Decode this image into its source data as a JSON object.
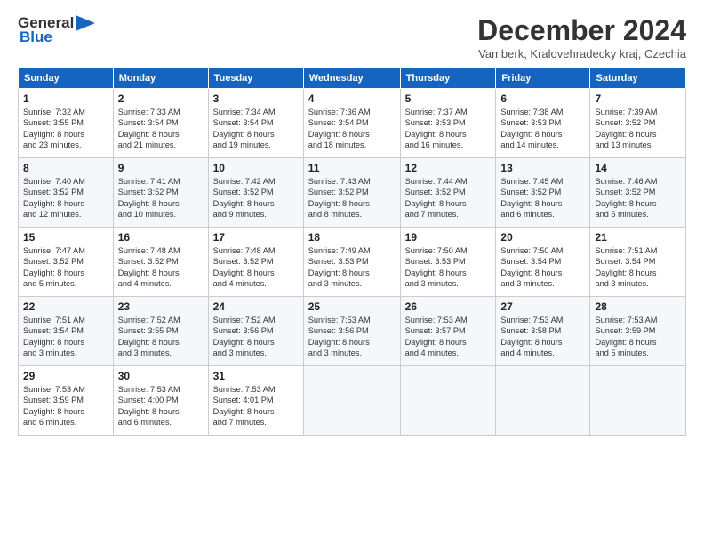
{
  "header": {
    "logo_general": "General",
    "logo_blue": "Blue",
    "month_title": "December 2024",
    "subtitle": "Vamberk, Kralovehradecky kraj, Czechia"
  },
  "weekdays": [
    "Sunday",
    "Monday",
    "Tuesday",
    "Wednesday",
    "Thursday",
    "Friday",
    "Saturday"
  ],
  "weeks": [
    [
      {
        "day": "1",
        "info": "Sunrise: 7:32 AM\nSunset: 3:55 PM\nDaylight: 8 hours\nand 23 minutes."
      },
      {
        "day": "2",
        "info": "Sunrise: 7:33 AM\nSunset: 3:54 PM\nDaylight: 8 hours\nand 21 minutes."
      },
      {
        "day": "3",
        "info": "Sunrise: 7:34 AM\nSunset: 3:54 PM\nDaylight: 8 hours\nand 19 minutes."
      },
      {
        "day": "4",
        "info": "Sunrise: 7:36 AM\nSunset: 3:54 PM\nDaylight: 8 hours\nand 18 minutes."
      },
      {
        "day": "5",
        "info": "Sunrise: 7:37 AM\nSunset: 3:53 PM\nDaylight: 8 hours\nand 16 minutes."
      },
      {
        "day": "6",
        "info": "Sunrise: 7:38 AM\nSunset: 3:53 PM\nDaylight: 8 hours\nand 14 minutes."
      },
      {
        "day": "7",
        "info": "Sunrise: 7:39 AM\nSunset: 3:52 PM\nDaylight: 8 hours\nand 13 minutes."
      }
    ],
    [
      {
        "day": "8",
        "info": "Sunrise: 7:40 AM\nSunset: 3:52 PM\nDaylight: 8 hours\nand 12 minutes."
      },
      {
        "day": "9",
        "info": "Sunrise: 7:41 AM\nSunset: 3:52 PM\nDaylight: 8 hours\nand 10 minutes."
      },
      {
        "day": "10",
        "info": "Sunrise: 7:42 AM\nSunset: 3:52 PM\nDaylight: 8 hours\nand 9 minutes."
      },
      {
        "day": "11",
        "info": "Sunrise: 7:43 AM\nSunset: 3:52 PM\nDaylight: 8 hours\nand 8 minutes."
      },
      {
        "day": "12",
        "info": "Sunrise: 7:44 AM\nSunset: 3:52 PM\nDaylight: 8 hours\nand 7 minutes."
      },
      {
        "day": "13",
        "info": "Sunrise: 7:45 AM\nSunset: 3:52 PM\nDaylight: 8 hours\nand 6 minutes."
      },
      {
        "day": "14",
        "info": "Sunrise: 7:46 AM\nSunset: 3:52 PM\nDaylight: 8 hours\nand 5 minutes."
      }
    ],
    [
      {
        "day": "15",
        "info": "Sunrise: 7:47 AM\nSunset: 3:52 PM\nDaylight: 8 hours\nand 5 minutes."
      },
      {
        "day": "16",
        "info": "Sunrise: 7:48 AM\nSunset: 3:52 PM\nDaylight: 8 hours\nand 4 minutes."
      },
      {
        "day": "17",
        "info": "Sunrise: 7:48 AM\nSunset: 3:52 PM\nDaylight: 8 hours\nand 4 minutes."
      },
      {
        "day": "18",
        "info": "Sunrise: 7:49 AM\nSunset: 3:53 PM\nDaylight: 8 hours\nand 3 minutes."
      },
      {
        "day": "19",
        "info": "Sunrise: 7:50 AM\nSunset: 3:53 PM\nDaylight: 8 hours\nand 3 minutes."
      },
      {
        "day": "20",
        "info": "Sunrise: 7:50 AM\nSunset: 3:54 PM\nDaylight: 8 hours\nand 3 minutes."
      },
      {
        "day": "21",
        "info": "Sunrise: 7:51 AM\nSunset: 3:54 PM\nDaylight: 8 hours\nand 3 minutes."
      }
    ],
    [
      {
        "day": "22",
        "info": "Sunrise: 7:51 AM\nSunset: 3:54 PM\nDaylight: 8 hours\nand 3 minutes."
      },
      {
        "day": "23",
        "info": "Sunrise: 7:52 AM\nSunset: 3:55 PM\nDaylight: 8 hours\nand 3 minutes."
      },
      {
        "day": "24",
        "info": "Sunrise: 7:52 AM\nSunset: 3:56 PM\nDaylight: 8 hours\nand 3 minutes."
      },
      {
        "day": "25",
        "info": "Sunrise: 7:53 AM\nSunset: 3:56 PM\nDaylight: 8 hours\nand 3 minutes."
      },
      {
        "day": "26",
        "info": "Sunrise: 7:53 AM\nSunset: 3:57 PM\nDaylight: 8 hours\nand 4 minutes."
      },
      {
        "day": "27",
        "info": "Sunrise: 7:53 AM\nSunset: 3:58 PM\nDaylight: 8 hours\nand 4 minutes."
      },
      {
        "day": "28",
        "info": "Sunrise: 7:53 AM\nSunset: 3:59 PM\nDaylight: 8 hours\nand 5 minutes."
      }
    ],
    [
      {
        "day": "29",
        "info": "Sunrise: 7:53 AM\nSunset: 3:59 PM\nDaylight: 8 hours\nand 6 minutes."
      },
      {
        "day": "30",
        "info": "Sunrise: 7:53 AM\nSunset: 4:00 PM\nDaylight: 8 hours\nand 6 minutes."
      },
      {
        "day": "31",
        "info": "Sunrise: 7:53 AM\nSunset: 4:01 PM\nDaylight: 8 hours\nand 7 minutes."
      },
      null,
      null,
      null,
      null
    ]
  ]
}
